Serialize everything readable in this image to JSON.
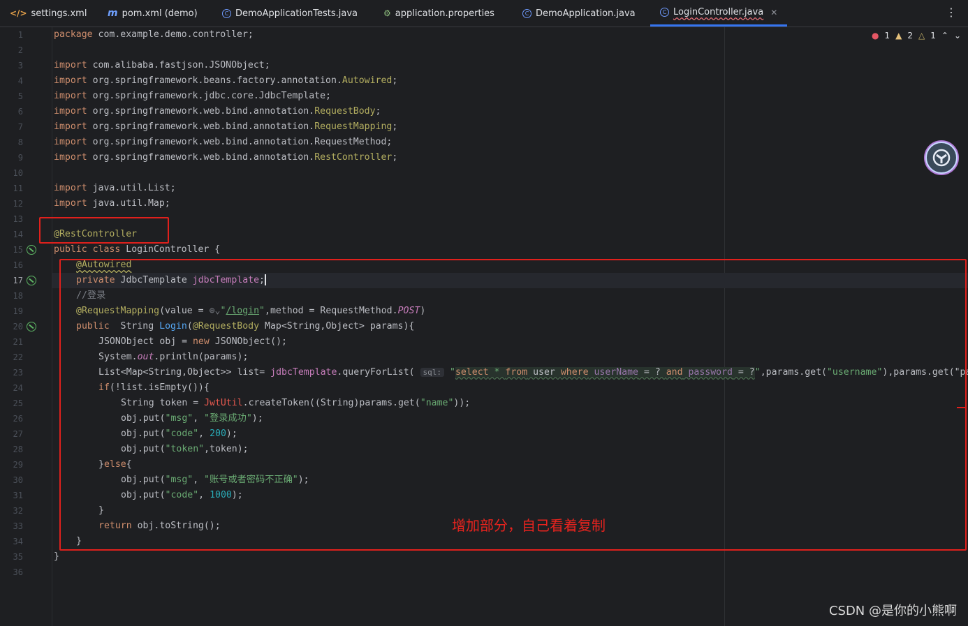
{
  "tabs": [
    {
      "label": "settings.xml",
      "icon": "xml-file-icon"
    },
    {
      "label": "pom.xml (demo)",
      "icon": "maven-icon"
    },
    {
      "label": "DemoApplicationTests.java",
      "icon": "java-class-icon"
    },
    {
      "label": "application.properties",
      "icon": "properties-file-icon"
    },
    {
      "label": "DemoApplication.java",
      "icon": "java-class-icon"
    },
    {
      "label": "LoginController.java",
      "icon": "java-class-icon"
    }
  ],
  "inspection": {
    "errors": "1",
    "warnings": "2",
    "weak_warnings": "1"
  },
  "line_numbers": [
    "1",
    "2",
    "3",
    "4",
    "5",
    "6",
    "7",
    "8",
    "9",
    "10",
    "11",
    "12",
    "13",
    "14",
    "15",
    "16",
    "17",
    "18",
    "19",
    "20",
    "21",
    "22",
    "23",
    "24",
    "25",
    "26",
    "27",
    "28",
    "29",
    "30",
    "31",
    "32",
    "33",
    "34",
    "35",
    "36"
  ],
  "code": {
    "l1_pkg": "com.example.demo.controller;",
    "l3": "com.alibaba.fastjson.JSONObject;",
    "l4_a": "org.springframework.beans.factory.annotation.",
    "l4_b": "Autowired",
    "l5": "org.springframework.jdbc.core.JdbcTemplate;",
    "l6_a": "org.springframework.web.bind.annotation.",
    "l6_b": "RequestBody",
    "l7_b": "RequestMapping",
    "l8": "org.springframework.web.bind.annotation.RequestMethod;",
    "l9_b": "RestController",
    "l11": "java.util.List;",
    "l12": "java.util.Map;",
    "l14": "@RestController",
    "l15": "LoginController {",
    "l16": "@Autowired",
    "l17_type": "JdbcTemplate",
    "l17_field": "jdbcTemplate",
    "l18": "//登录",
    "l19_ann": "@RequestMapping",
    "l19_a": "(value = ",
    "l19_url": "/login",
    "l19_b": ",method = RequestMethod.",
    "l19_post": "POST",
    "l20_ret": "String",
    "l20_fn": "Login",
    "l20_ann": "@RequestBody",
    "l20_rest": " Map<String,Object> params){",
    "l21_a": "JSONObject obj = ",
    "l21_b": "JSONObject();",
    "l22_a": "System.",
    "l22_out": "out",
    "l22_b": ".println(params);",
    "l23_a": "List<Map<String,Object>> list= ",
    "l23_field": "jdbcTemplate",
    "l23_b": ".queryForList(",
    "l23_hint": "sql:",
    "l23_rest": ",params.get(",
    "l23_user": "\"username\"",
    "l23_tail": "),params.get(\"pa",
    "sql": {
      "select": "select",
      "star": " * ",
      "from": "from",
      "user": " user ",
      "where": "where",
      "username": " userName",
      "eq1": " = ? ",
      "and": "and",
      "password": " password",
      "eq2": " = ?"
    },
    "l24": "if(!list.isEmpty()){",
    "l25_a": "String token = ",
    "l25_cls": "JwtUtil",
    "l25_b": ".createToken((String)params.get(",
    "l25_str": "\"name\"",
    "l25_c": "));",
    "l26_a": "obj.put(",
    "l26_k": "\"msg\"",
    "l26_v": "\"登录成功\"",
    "l26_c": ");",
    "l27_k": "\"code\"",
    "l27_v": "200",
    "l28_k": "\"token\"",
    "l28_b": ",token);",
    "l29": "}else{",
    "l30_v": "\"账号或者密码不正确\"",
    "l31_v": "1000",
    "l32": "}",
    "l33_kw": "return",
    "l33_b": " obj.toString();",
    "l34": "}",
    "l35": "}"
  },
  "keywords": {
    "package": "package",
    "import": "import",
    "public": "public",
    "class": "class",
    "private": "private",
    "new": "new",
    "return": "return"
  },
  "annotation_note": "增加部分，自己看着复制",
  "watermark": "CSDN @是你的小熊啊",
  "colors": {
    "background": "#1e1f22",
    "keyword": "#cf8e6d",
    "string": "#6aab73",
    "annotation": "#b3ae60",
    "highlight_box": "#e0201c"
  }
}
